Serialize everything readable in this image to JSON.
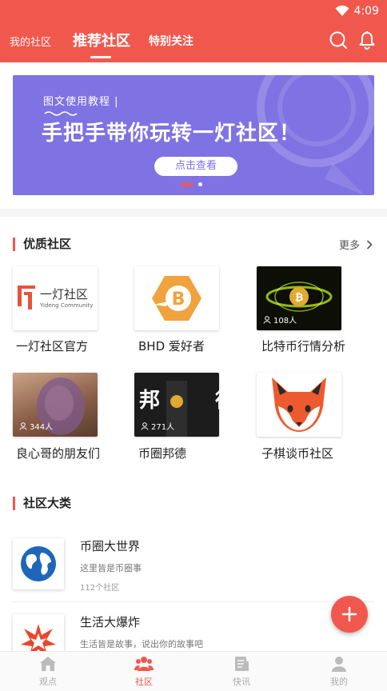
{
  "statusbar": {
    "time": "4:09"
  },
  "header": {
    "tabs": [
      {
        "label": "我的社区"
      },
      {
        "label": "推荐社区"
      },
      {
        "label": "特别关注"
      }
    ]
  },
  "banner": {
    "subtitle": "图文使用教程 |",
    "title": "手把手带你玩转一灯社区！",
    "button_label": "点击查看"
  },
  "featured": {
    "title": "优质社区",
    "more_label": "更多",
    "items": [
      {
        "name": "一灯社区官方",
        "logo_text": "一灯社区",
        "logo_sub": "Yideng Community"
      },
      {
        "name": "BHD 爱好者"
      },
      {
        "name": "比特币行情分析",
        "count": "108人"
      },
      {
        "name": "良心哥的朋友们",
        "count": "344人"
      },
      {
        "name": "币圈邦德",
        "count": "271人",
        "overlay": "邦 德"
      },
      {
        "name": "子棋谈币社区"
      }
    ]
  },
  "categories": {
    "title": "社区大类",
    "items": [
      {
        "name": "币圈大世界",
        "desc": "这里皆是币圈事",
        "count": "112个社区"
      },
      {
        "name": "生活大爆炸",
        "desc": "生活皆是故事，说出你的故事吧"
      }
    ]
  },
  "bottom_nav": {
    "items": [
      {
        "label": "观点"
      },
      {
        "label": "社区"
      },
      {
        "label": "快讯"
      },
      {
        "label": "我的"
      }
    ]
  },
  "colors": {
    "accent": "#f0584e",
    "banner": "#7f72e2"
  }
}
